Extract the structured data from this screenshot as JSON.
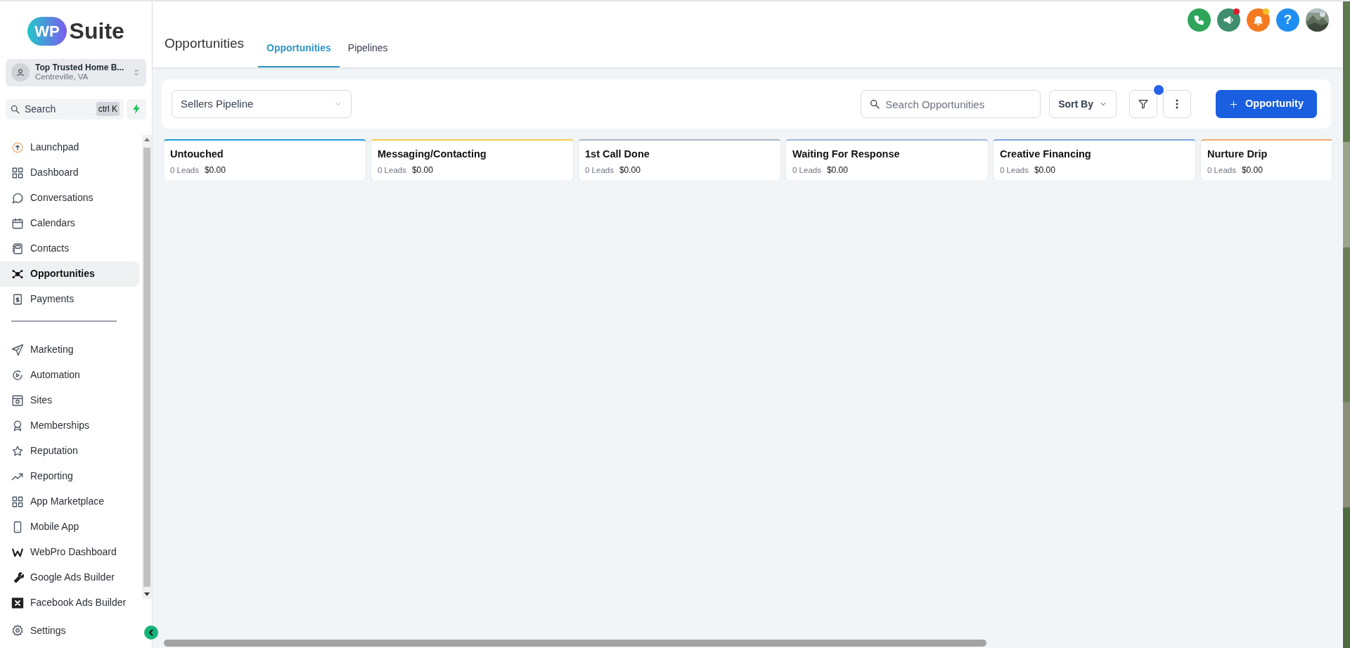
{
  "sidebar": {
    "logo": {
      "badge": "WP",
      "word": "Suite"
    },
    "account": {
      "name": "Top Trusted Home B...",
      "location": "Centreville, VA"
    },
    "search": {
      "placeholder": "Search",
      "shortcut": "ctrl K"
    },
    "nav_main": [
      {
        "label": "Launchpad",
        "kind": "launchpad",
        "selected": false
      },
      {
        "label": "Dashboard",
        "kind": "grid",
        "selected": false
      },
      {
        "label": "Conversations",
        "kind": "chat",
        "selected": false
      },
      {
        "label": "Calendars",
        "kind": "calendar",
        "selected": false
      },
      {
        "label": "Contacts",
        "kind": "contacts",
        "selected": false
      },
      {
        "label": "Opportunities",
        "kind": "network",
        "selected": true
      },
      {
        "label": "Payments",
        "kind": "payments",
        "selected": false
      }
    ],
    "nav_more": [
      {
        "label": "Marketing",
        "kind": "send",
        "selected": false
      },
      {
        "label": "Automation",
        "kind": "automation",
        "selected": false
      },
      {
        "label": "Sites",
        "kind": "sites",
        "selected": false
      },
      {
        "label": "Memberships",
        "kind": "award",
        "selected": false
      },
      {
        "label": "Reputation",
        "kind": "star",
        "selected": false
      },
      {
        "label": "Reporting",
        "kind": "trend",
        "selected": false
      },
      {
        "label": "App Marketplace",
        "kind": "grid",
        "selected": false
      },
      {
        "label": "Mobile App",
        "kind": "mobile",
        "selected": false
      },
      {
        "label": "WebPro Dashboard",
        "kind": "webpro",
        "selected": false
      },
      {
        "label": "Google Ads Builder",
        "kind": "wrench",
        "selected": false
      },
      {
        "label": "Facebook Ads Builder",
        "kind": "xbox",
        "selected": false
      }
    ],
    "settings": {
      "label": "Settings",
      "kind": "gear",
      "selected": false
    }
  },
  "header": {
    "title": "Opportunities",
    "tabs": [
      {
        "label": "Opportunities",
        "selected": true
      },
      {
        "label": "Pipelines",
        "selected": false
      }
    ],
    "actions": [
      {
        "kind": "phone",
        "color": "#2ea55a",
        "notification": false
      },
      {
        "kind": "megaphone",
        "color": "#3f8f6e",
        "notification": true
      },
      {
        "kind": "bell",
        "color": "#f47a1f",
        "notification": true
      },
      {
        "kind": "help",
        "color": "#1f8ef1",
        "notification": false,
        "text": "?"
      },
      {
        "kind": "avatar",
        "notification": false
      }
    ]
  },
  "toolbar": {
    "pipeline": "Sellers Pipeline",
    "search_placeholder": "Search Opportunities",
    "sort": "Sort By",
    "filter_active": true,
    "add_button": "Opportunity"
  },
  "stages": [
    {
      "name": "Untouched",
      "leads": "0 Leads",
      "amount": "$0.00",
      "color": "#1e9bd7"
    },
    {
      "name": "Messaging/Contacting",
      "leads": "0 Leads",
      "amount": "$0.00",
      "color": "#f2c94c"
    },
    {
      "name": "1st Call Done",
      "leads": "0 Leads",
      "amount": "$0.00",
      "color": "#a9b4c0"
    },
    {
      "name": "Waiting For Response",
      "leads": "0 Leads",
      "amount": "$0.00",
      "color": "#9cb8d8"
    },
    {
      "name": "Creative Financing",
      "leads": "0 Leads",
      "amount": "$0.00",
      "color": "#7ea6dc"
    },
    {
      "name": "Nurture Drip",
      "leads": "0 Leads",
      "amount": "$0.00",
      "color": "#f0aa70"
    }
  ]
}
